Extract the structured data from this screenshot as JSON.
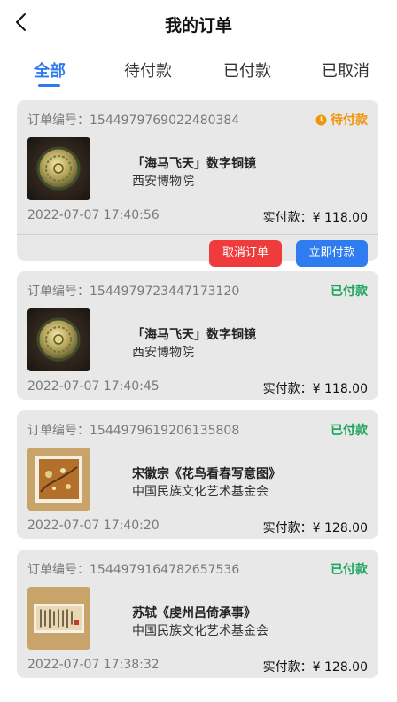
{
  "header": {
    "title": "我的订单"
  },
  "tabs": [
    {
      "label": "全部",
      "active": true
    },
    {
      "label": "待付款",
      "active": false
    },
    {
      "label": "已付款",
      "active": false
    },
    {
      "label": "已取消",
      "active": false
    }
  ],
  "orders": [
    {
      "order_label": "订单编号：",
      "order_no": "1544979769022480384",
      "status": "待付款",
      "status_color": "#f0950a",
      "item_name": "「海马飞天」数字铜镜",
      "item_org": "西安博物院",
      "date": "2022-07-07 17:40:56",
      "price_label": "实付款：",
      "price": "¥ 118.00",
      "actions": {
        "cancel": "取消订单",
        "pay": "立即付款"
      }
    },
    {
      "order_label": "订单编号：",
      "order_no": "1544979723447173120",
      "status": "已付款",
      "status_color": "#1ca55b",
      "item_name": "「海马飞天」数字铜镜",
      "item_org": "西安博物院",
      "date": "2022-07-07 17:40:45",
      "price_label": "实付款：",
      "price": "¥ 118.00"
    },
    {
      "order_label": "订单编号：",
      "order_no": "1544979619206135808",
      "status": "已付款",
      "status_color": "#1ca55b",
      "item_name": "宋徽宗《花鸟看春写意图》",
      "item_org": "中国民族文化艺术基金会",
      "date": "2022-07-07 17:40:20",
      "price_label": "实付款：",
      "price": "¥ 128.00"
    },
    {
      "order_label": "订单编号：",
      "order_no": "1544979164782657536",
      "status": "已付款",
      "status_color": "#1ca55b",
      "item_name": "苏轼《虔州吕倚承事》",
      "item_org": "中国民族文化艺术基金会",
      "date": "2022-07-07 17:38:32",
      "price_label": "实付款：",
      "price": "¥ 128.00"
    }
  ],
  "icons": {
    "back": "back-arrow-icon",
    "clock": "clock-icon"
  },
  "colors": {
    "accent": "#2f7bf0",
    "cancel": "#ef3b3b",
    "card_bg": "#e8e8e8"
  }
}
